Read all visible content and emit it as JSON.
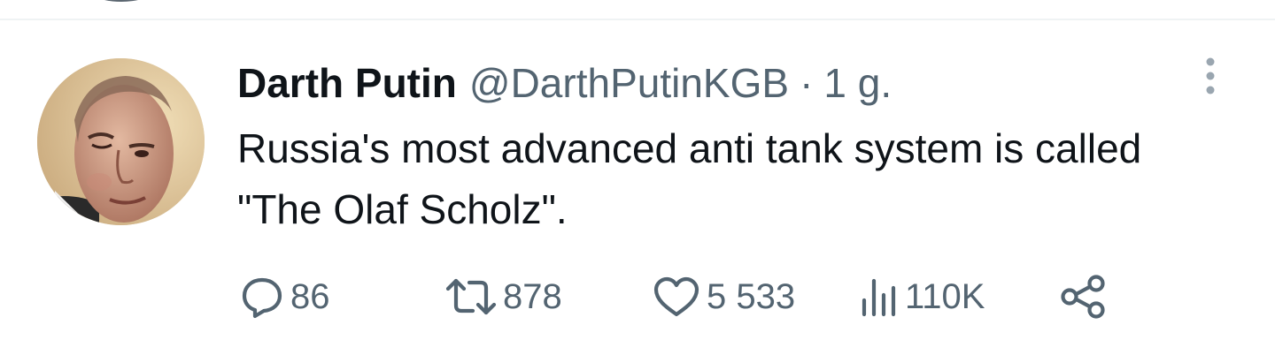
{
  "tweet": {
    "display_name": "Darth Putin",
    "handle": "@DarthPutinKGB",
    "separator": "·",
    "time": "1 g.",
    "text": "Russia's most advanced anti tank system is called \"The Olaf Scholz\"."
  },
  "actions": {
    "reply_count": "86",
    "retweet_count": "878",
    "like_count": "5 533",
    "views_count": "110K"
  },
  "icons": {
    "reply": "reply-icon",
    "retweet": "retweet-icon",
    "like": "heart-icon",
    "views": "views-icon",
    "share": "share-icon",
    "more": "more-vertical-icon"
  },
  "colors": {
    "text_primary": "#0f1419",
    "text_secondary": "#536471",
    "divider": "#eff3f4"
  }
}
